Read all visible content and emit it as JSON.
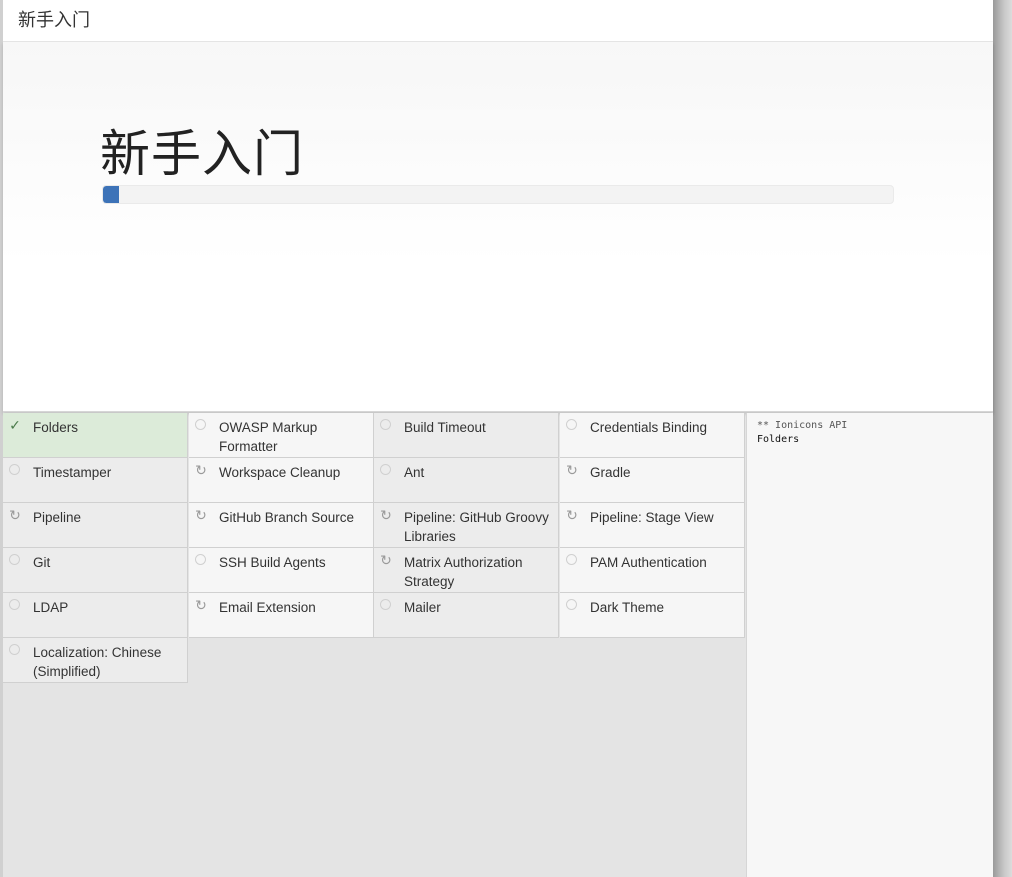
{
  "topbar": {
    "title": "新手入门"
  },
  "hero": {
    "title": "新手入门",
    "progress_fraction": 0.02
  },
  "plugins": [
    {
      "label": "Folders",
      "state": "installed"
    },
    {
      "label": "OWASP Markup Formatter",
      "state": "pending"
    },
    {
      "label": "Build Timeout",
      "state": "pending"
    },
    {
      "label": "Credentials Binding",
      "state": "pending"
    },
    {
      "label": "Timestamper",
      "state": "pending"
    },
    {
      "label": "Workspace Cleanup",
      "state": "installing"
    },
    {
      "label": "Ant",
      "state": "pending"
    },
    {
      "label": "Gradle",
      "state": "installing"
    },
    {
      "label": "Pipeline",
      "state": "installing"
    },
    {
      "label": "GitHub Branch Source",
      "state": "installing"
    },
    {
      "label": "Pipeline: GitHub Groovy Libraries",
      "state": "installing"
    },
    {
      "label": "Pipeline: Stage View",
      "state": "installing"
    },
    {
      "label": "Git",
      "state": "pending"
    },
    {
      "label": "SSH Build Agents",
      "state": "pending"
    },
    {
      "label": "Matrix Authorization Strategy",
      "state": "installing"
    },
    {
      "label": "PAM Authentication",
      "state": "pending"
    },
    {
      "label": "LDAP",
      "state": "pending"
    },
    {
      "label": "Email Extension",
      "state": "installing"
    },
    {
      "label": "Mailer",
      "state": "pending"
    },
    {
      "label": "Dark Theme",
      "state": "pending"
    },
    {
      "label": "Localization: Chinese (Simplified)",
      "state": "pending"
    }
  ],
  "log": {
    "lines": [
      "** Ionicons API",
      "Folders"
    ]
  },
  "colors": {
    "progress": "#3d73b8",
    "installed_bg": "#dcebd9"
  },
  "icons": {
    "installed": "check-icon",
    "installing": "refresh-icon",
    "pending": "circle-icon"
  }
}
